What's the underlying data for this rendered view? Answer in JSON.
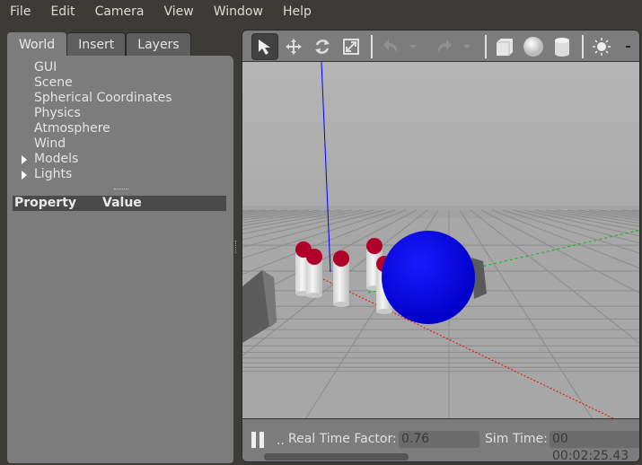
{
  "menu": [
    "File",
    "Edit",
    "Camera",
    "View",
    "Window",
    "Help"
  ],
  "left_tabs": [
    "World",
    "Insert",
    "Layers"
  ],
  "tree": [
    {
      "label": "GUI"
    },
    {
      "label": "Scene"
    },
    {
      "label": "Spherical Coordinates"
    },
    {
      "label": "Physics"
    },
    {
      "label": "Atmosphere"
    },
    {
      "label": "Wind"
    },
    {
      "label": "Models",
      "expandable": true
    },
    {
      "label": "Lights",
      "expandable": true
    }
  ],
  "property_header": {
    "property": "Property",
    "value": "Value"
  },
  "toolbar": [
    "select-arrow",
    "translate",
    "rotate",
    "scale",
    "undo",
    "redo",
    "box",
    "sphere",
    "cylinder",
    "sun-light"
  ],
  "status": {
    "rtf_label": "Real Time Factor:",
    "rtf_value": "0.76",
    "sim_label": "Sim Time:",
    "sim_value": "00 00:02:25.43",
    "dots": ".."
  },
  "colors": {
    "sphere": "#0000e6",
    "x_axis": "#ff0000",
    "y_axis": "#00c000",
    "z_axis": "#0000ff",
    "marker": "#b0002a"
  }
}
